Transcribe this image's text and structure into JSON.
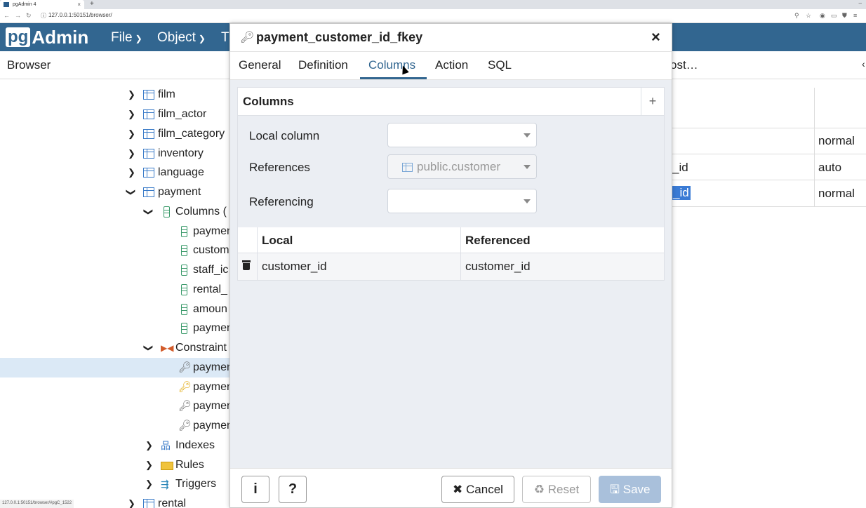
{
  "browser_tab": {
    "title": "pgAdmin 4",
    "close": "×",
    "new_tab": "+"
  },
  "address_bar": {
    "url": "127.0.0.1:50151/browser/"
  },
  "app": {
    "logo_pg": "pg",
    "logo_admin": "Admin",
    "menus": [
      {
        "label": "File"
      },
      {
        "label": "Object"
      },
      {
        "label": "T"
      }
    ]
  },
  "browser_panel": {
    "title": "Browser"
  },
  "right_panel": {
    "partial_title": "ost…",
    "arrow": "‹"
  },
  "tree": {
    "tables": [
      "film",
      "film_actor",
      "film_category",
      "inventory",
      "language",
      "payment"
    ],
    "columns_label": "Columns (",
    "columns": [
      "paymen",
      "custom",
      "staff_ic",
      "rental_",
      "amoun",
      "paymen"
    ],
    "constraints_label": "Constraint",
    "constraints": [
      "paymen",
      "paymen",
      "paymen",
      "paymen"
    ],
    "indexes_label": "Indexes",
    "rules_label": "Rules",
    "triggers_label": "Triggers",
    "next_table": "rental"
  },
  "right_grid": {
    "rows": [
      {
        "left": "",
        "right": "normal"
      },
      {
        "left": "_id",
        "right": "auto"
      },
      {
        "left": "_id",
        "right": "normal"
      }
    ]
  },
  "status_url": "127.0.0.1:50151/browser/#pgC_1522",
  "dialog": {
    "title": "payment_customer_id_fkey",
    "close": "×",
    "tabs": [
      "General",
      "Definition",
      "Columns",
      "Action",
      "SQL"
    ],
    "active_tab": "Columns",
    "section_title": "Columns",
    "add": "+",
    "fields": {
      "local_column": {
        "label": "Local column",
        "value": ""
      },
      "references": {
        "label": "References",
        "value": "public.customer"
      },
      "referencing": {
        "label": "Referencing",
        "value": ""
      }
    },
    "table": {
      "headers": [
        "Local",
        "Referenced"
      ],
      "rows": [
        {
          "local": "customer_id",
          "referenced": "customer_id"
        }
      ]
    },
    "footer": {
      "info": "i",
      "help": "?",
      "cancel": "Cancel",
      "reset": "Reset",
      "save": "Save"
    }
  }
}
